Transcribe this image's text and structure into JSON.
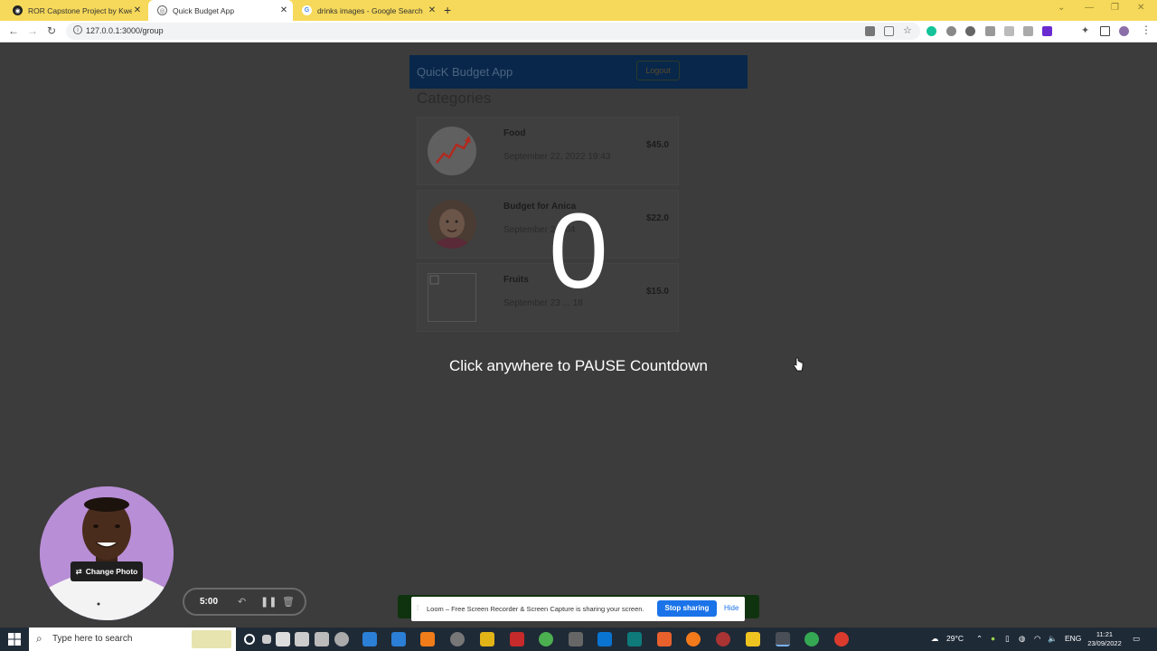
{
  "browser": {
    "tabs": [
      {
        "title": "ROR Capstone Project by Kwente",
        "active": false
      },
      {
        "title": "Quick Budget App",
        "active": true
      },
      {
        "title": "drinks images - Google Search",
        "active": false
      }
    ],
    "url": "127.0.0.1:3000/group"
  },
  "app": {
    "brand": "QuicK Budget App",
    "logout_label": "Logout",
    "section_title": "Categories",
    "categories": [
      {
        "name": "Food",
        "date": "September 22, 2022 19:43",
        "amount": "$45.0"
      },
      {
        "name": "Budget for Anica",
        "date": "September 2... 04",
        "amount": "$22.0"
      },
      {
        "name": "Fruits",
        "date": "September 23 ... 18",
        "amount": "$15.0"
      }
    ]
  },
  "overlay": {
    "countdown": "0",
    "message": "Click anywhere to PAUSE Countdown"
  },
  "loom": {
    "change_photo_label": "Change Photo",
    "timer": "5:00",
    "share_message": "Loom – Free Screen Recorder & Screen Capture is sharing your screen.",
    "stop_sharing_label": "Stop sharing",
    "hide_label": "Hide"
  },
  "taskbar": {
    "search_placeholder": "Type here to search",
    "weather": "29°C",
    "language": "ENG",
    "time": "11:21",
    "date": "23/09/2022"
  }
}
